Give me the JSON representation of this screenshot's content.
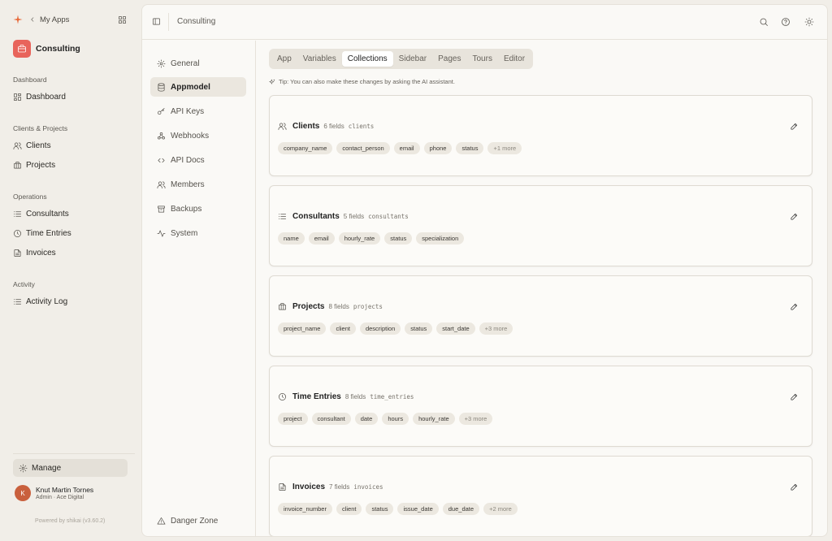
{
  "topbar": {
    "my_apps": "My Apps"
  },
  "app": {
    "name": "Consulting"
  },
  "sidebar": {
    "sections": {
      "dashboard": "Dashboard",
      "clients_projects": "Clients & Projects",
      "operations": "Operations",
      "activity": "Activity"
    },
    "items": {
      "dashboard": "Dashboard",
      "clients": "Clients",
      "projects": "Projects",
      "consultants": "Consultants",
      "time_entries": "Time Entries",
      "invoices": "Invoices",
      "activity_log": "Activity Log"
    },
    "manage": "Manage",
    "user": {
      "initial": "K",
      "name": "Knut Martin Tornes",
      "role": "Admin · Ace Digital"
    },
    "powered": "Powered by shikai (v3.60.2)"
  },
  "panel": {
    "title": "Consulting"
  },
  "settings_nav": {
    "general": "General",
    "appmodel": "Appmodel",
    "api_keys": "API Keys",
    "webhooks": "Webhooks",
    "api_docs": "API Docs",
    "members": "Members",
    "backups": "Backups",
    "system": "System",
    "danger_zone": "Danger Zone"
  },
  "tabs": [
    "App",
    "Variables",
    "Collections",
    "Sidebar",
    "Pages",
    "Tours",
    "Editor"
  ],
  "active_tab": "Collections",
  "tip": "Tip: You can also make these changes by asking the AI assistant.",
  "collections": [
    {
      "name": "Clients",
      "count": "6 fields",
      "slug": "clients",
      "fields": [
        "company_name",
        "contact_person",
        "email",
        "phone",
        "status"
      ],
      "more": "+1 more",
      "icon": "users-icon"
    },
    {
      "name": "Consultants",
      "count": "5 fields",
      "slug": "consultants",
      "fields": [
        "name",
        "email",
        "hourly_rate",
        "status",
        "specialization"
      ],
      "more": "",
      "icon": "list-icon"
    },
    {
      "name": "Projects",
      "count": "8 fields",
      "slug": "projects",
      "fields": [
        "project_name",
        "client",
        "description",
        "status",
        "start_date"
      ],
      "more": "+3 more",
      "icon": "briefcase-icon"
    },
    {
      "name": "Time Entries",
      "count": "8 fields",
      "slug": "time_entries",
      "fields": [
        "project",
        "consultant",
        "date",
        "hours",
        "hourly_rate"
      ],
      "more": "+3 more",
      "icon": "clock-icon"
    },
    {
      "name": "Invoices",
      "count": "7 fields",
      "slug": "invoices",
      "fields": [
        "invoice_number",
        "client",
        "status",
        "issue_date",
        "due_date"
      ],
      "more": "+2 more",
      "icon": "document-icon"
    }
  ],
  "colors": {
    "accent": "#e86a3a",
    "app_logo": "#e8645b",
    "avatar": "#c9603d"
  }
}
